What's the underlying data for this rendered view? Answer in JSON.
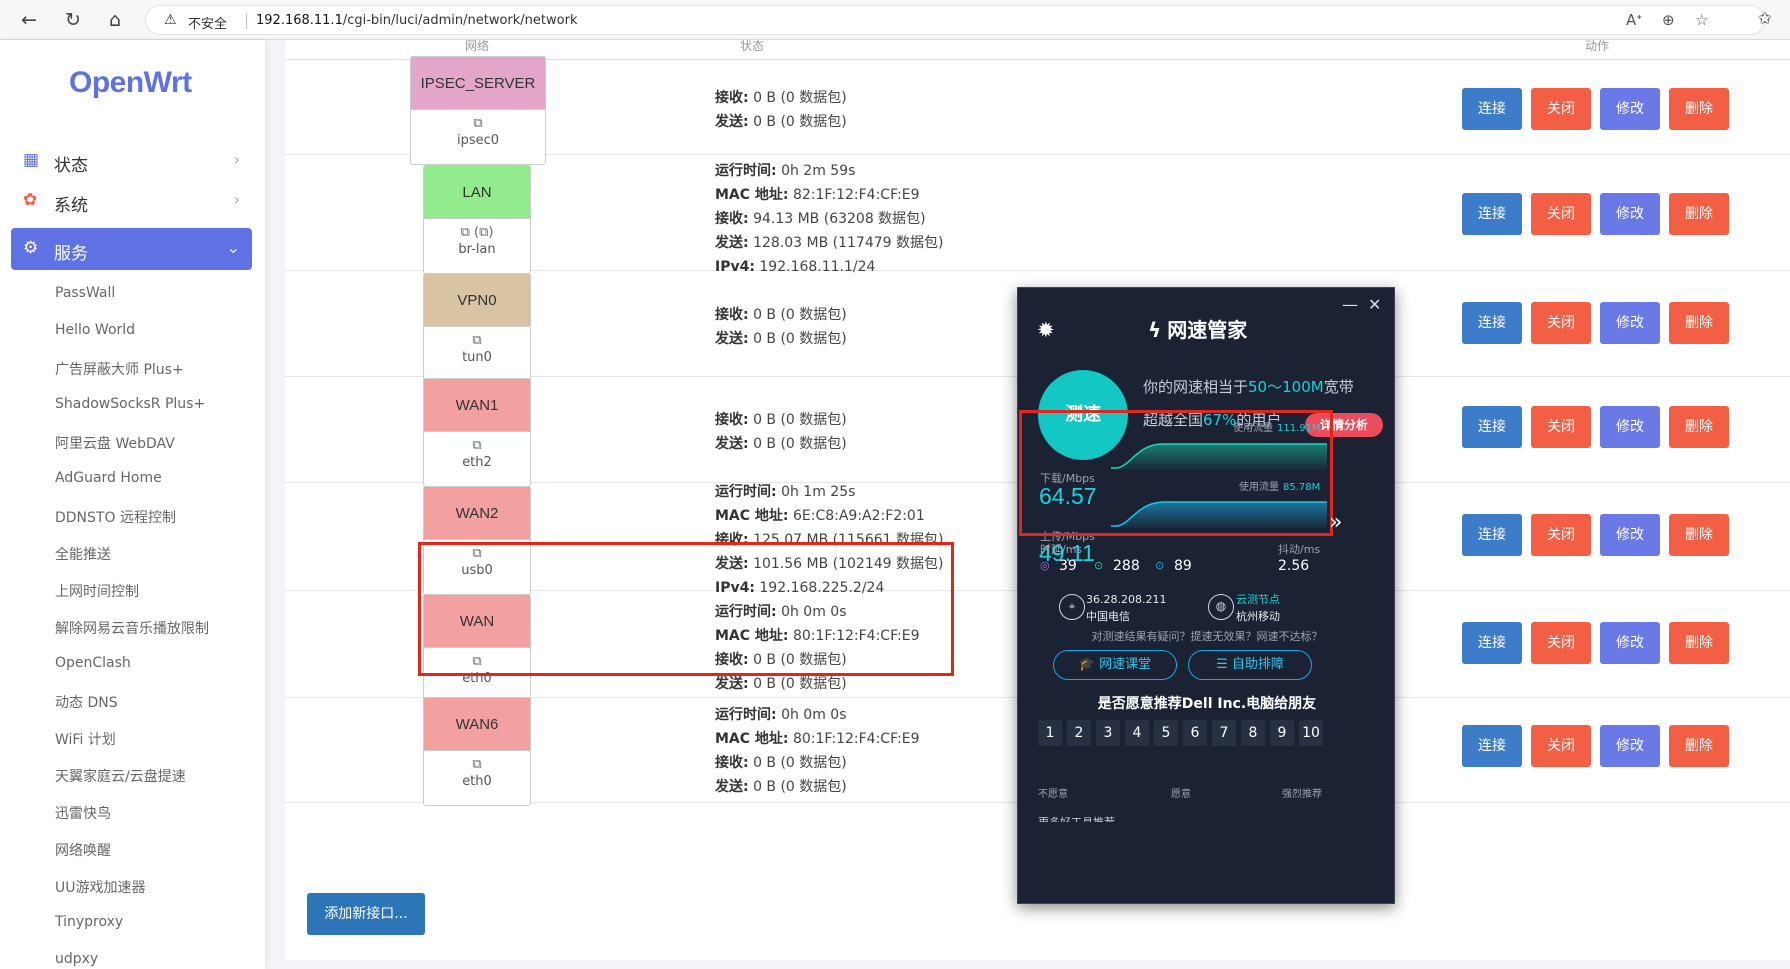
{
  "browser": {
    "insecure_label": "不安全",
    "url_host": "192.168.11.1",
    "url_path": "/cgi-bin/luci/admin/network/network"
  },
  "sidebar": {
    "logo": "OpenWrt",
    "menu": [
      {
        "label": "状态",
        "icon": "dashboard-icon"
      },
      {
        "label": "系统",
        "icon": "gear-icon"
      },
      {
        "label": "服务",
        "icon": "gears-icon",
        "active": true
      }
    ],
    "sub_items": [
      "PassWall",
      "Hello World",
      "广告屏蔽大师 Plus+",
      "ShadowSocksR Plus+",
      "阿里云盘 WebDAV",
      "AdGuard Home",
      "DDNSTO 远程控制",
      "全能推送",
      "上网时间控制",
      "解除网易云音乐播放限制",
      "OpenClash",
      "动态 DNS",
      "WiFi 计划",
      "天翼家庭云/云盘提速",
      "迅雷快鸟",
      "网络唤醒",
      "UU游戏加速器",
      "Tinyproxy",
      "udpxy"
    ]
  },
  "table": {
    "header": [
      "网络",
      "状态",
      "动作"
    ],
    "labels": {
      "uptime": "运行时间:",
      "mac": "MAC 地址:",
      "rx": "接收:",
      "tx": "发送:",
      "ipv4": "IPv4:"
    },
    "actions": {
      "connect": "连接",
      "close": "关闭",
      "edit": "修改",
      "delete": "删除"
    },
    "rows": [
      {
        "name": "IPSEC_SERVER",
        "color": "#e4a6c8",
        "device": "ipsec0",
        "uptime": "",
        "mac": "",
        "rx": "0 B (0 数据包)",
        "tx": "0 B (0 数据包)",
        "ipv4": ""
      },
      {
        "name": "LAN",
        "color": "#92ec8e",
        "device": "br-lan",
        "uptime": "0h 2m 59s",
        "mac": "82:1F:12:F4:CF:E9",
        "rx": "94.13 MB (63208 数据包)",
        "tx": "128.03 MB (117479 数据包)",
        "ipv4": "192.168.11.1/24"
      },
      {
        "name": "VPN0",
        "color": "#d8c3a2",
        "device": "tun0",
        "uptime": "",
        "mac": "",
        "rx": "0 B (0 数据包)",
        "tx": "0 B (0 数据包)",
        "ipv4": ""
      },
      {
        "name": "WAN1",
        "color": "#f3a0a0",
        "device": "eth2",
        "uptime": "",
        "mac": "",
        "rx": "0 B (0 数据包)",
        "tx": "0 B (0 数据包)",
        "ipv4": ""
      },
      {
        "name": "WAN2",
        "color": "#f3a0a0",
        "device": "usb0",
        "uptime": "0h 1m 25s",
        "mac": "6E:C8:A9:A2:F2:01",
        "rx": "125.07 MB (115661 数据包)",
        "tx": "101.56 MB (102149 数据包)",
        "ipv4": "192.168.225.2/24"
      },
      {
        "name": "WAN",
        "color": "#f3a0a0",
        "device": "eth0",
        "uptime": "0h 0m 0s",
        "mac": "80:1F:12:F4:CF:E9",
        "rx": "0 B (0 数据包)",
        "tx": "0 B (0 数据包)",
        "ipv4": ""
      },
      {
        "name": "WAN6",
        "color": "#f3a0a0",
        "device": "eth0",
        "uptime": "0h 0m 0s",
        "mac": "80:1F:12:F4:CF:E9",
        "rx": "0 B (0 数据包)",
        "tx": "0 B (0 数据包)",
        "ipv4": ""
      }
    ],
    "add_button": "添加新接口..."
  },
  "widget": {
    "title": "网速管家",
    "test_button": "测速",
    "line1_prefix": "你的网速相当于",
    "line1_value": "50～100M",
    "line1_suffix": "宽带",
    "line2_prefix": "超越全国",
    "line2_value": "67%",
    "line2_suffix": "的用户",
    "detail_button": "详情分析",
    "download_label": "下载/Mbps",
    "download_value": "64.57",
    "download_usage_label": "使用流量",
    "download_usage": "111.91M",
    "upload_label": "上传/Mbps",
    "upload_value": "49.11",
    "upload_usage_label": "使用流量",
    "upload_usage": "85.78M",
    "latency_label": "时延/ms",
    "jitter_label": "抖动/ms",
    "latency": "39",
    "down_latency": "288",
    "up_latency": "89",
    "jitter": "2.56",
    "node1_ip": "36.28.208.211",
    "node1_isp": "中国电信",
    "node2_title": "云测节点",
    "node2_isp": "杭州移动",
    "question": "对测速结果有疑问？提速无效果？网速不达标？",
    "course_button": "网速课堂",
    "troubleshoot_button": "自助排障",
    "recommend_text": "是否愿意推荐Dell Inc.电脑给朋友",
    "scale": [
      "1",
      "2",
      "3",
      "4",
      "5",
      "6",
      "7",
      "8",
      "9",
      "10"
    ],
    "scale_low": "不愿意",
    "scale_mid": "愿意",
    "scale_high": "强烈推荐",
    "cut_text": "更多好工具推荐"
  }
}
